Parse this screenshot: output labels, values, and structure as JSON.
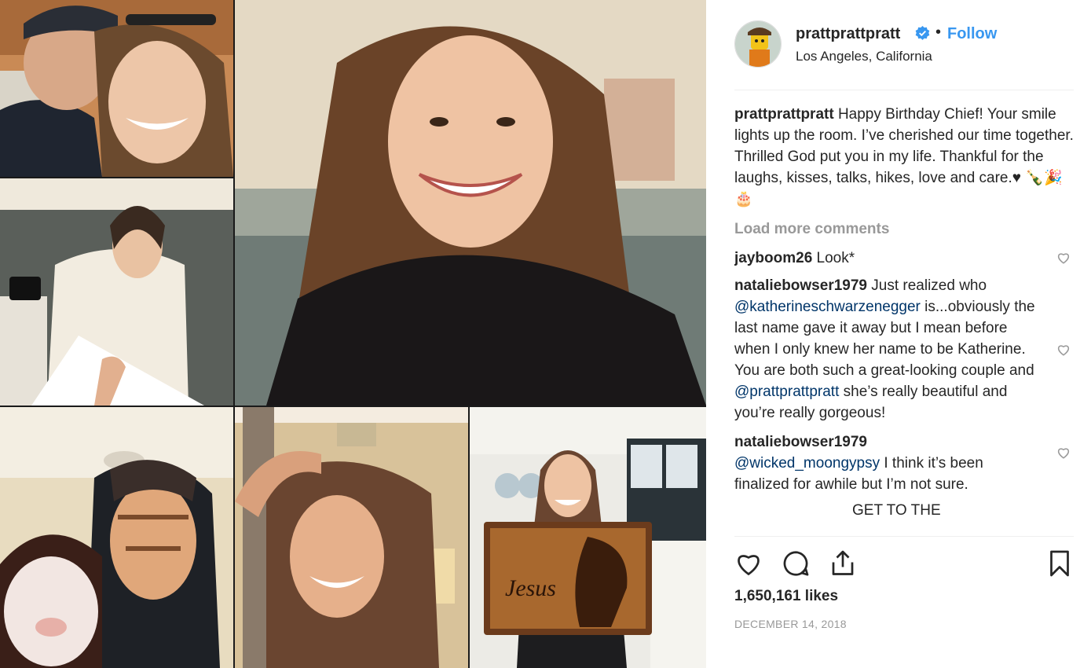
{
  "post": {
    "username": "prattprattpratt",
    "follow_label": "Follow",
    "separator": "•",
    "location": "Los Angeles, California",
    "caption_user": "prattprattpratt",
    "caption_text": " Happy Birthday Chief! Your smile lights up the room. I’ve cherished our time together. Thrilled God put you in my life. Thankful for the laughs, kisses, talks, hikes, love and care.♥ 🍾🎉🎂",
    "load_more": "Load more comments",
    "likes": "1,650,161 likes",
    "date": "DECEMBER 14, 2018",
    "photo_sign_text": "Jesus",
    "colors": {
      "accent": "#3897f0",
      "mention": "#003569",
      "muted": "#999999"
    },
    "icons": [
      "verified-badge-icon",
      "heart-icon",
      "comment-icon",
      "share-icon",
      "bookmark-icon"
    ]
  },
  "comments": [
    {
      "user": "jayboom26",
      "text": " Look*"
    },
    {
      "user": "nataliebowser1979",
      "text_a": " Just realized who ",
      "mention_a": "@katherineschwarzenegger",
      "text_b": " is...obviously the last name gave it away but I mean before when I only knew her name to be Katherine. You are both such a great-looking couple and ",
      "mention_b": "@prattprattpratt",
      "text_c": " she’s really beautiful and you’re really gorgeous!"
    },
    {
      "user": "nataliebowser1979",
      "mention": "@wicked_moongypsy",
      "text": " I think it’s been finalized for awhile but I’m not sure."
    },
    {
      "partial": "GET TO THE"
    }
  ]
}
